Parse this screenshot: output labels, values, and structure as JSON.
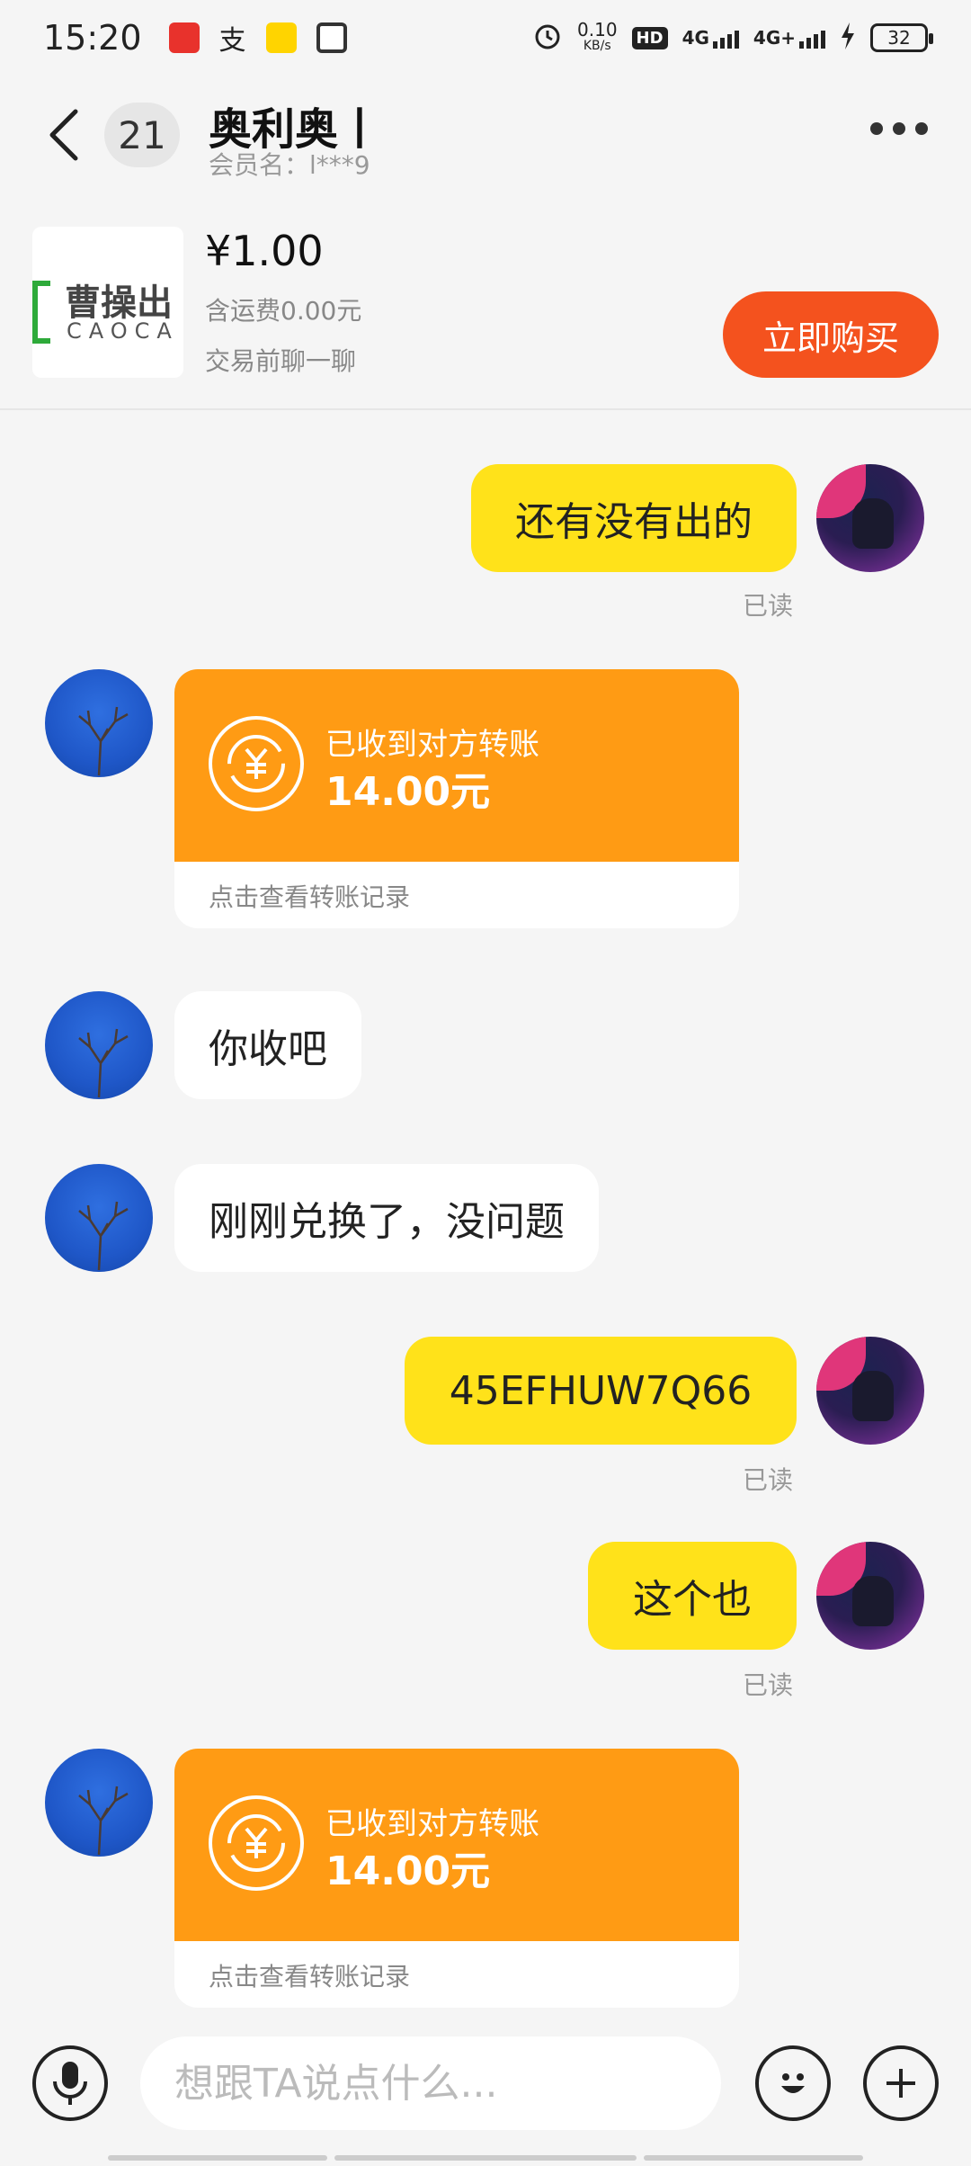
{
  "status_bar": {
    "time": "15:20",
    "net_speed_top": "0.10",
    "net_speed_bottom": "KB/s",
    "hd_label": "HD",
    "sim1_label": "4G",
    "sim2_label": "4G+",
    "battery": "32"
  },
  "header": {
    "unread_count": "21",
    "title": "奥利奥丨",
    "member_label": "会员名：l***9"
  },
  "product": {
    "logo_text_cn": "曹操出",
    "logo_text_en": "CAOCA",
    "price": "¥1.00",
    "shipping": "含运费0.00元",
    "chat_hint": "交易前聊一聊",
    "buy_label": "立即购买"
  },
  "messages": [
    {
      "side": "mine",
      "text": "还有没有出的",
      "status": "已读"
    },
    {
      "side": "theirs",
      "type": "transfer",
      "title": "已收到对方转账",
      "amount": "14.00元",
      "link": "点击查看转账记录"
    },
    {
      "side": "theirs",
      "text": "你收吧"
    },
    {
      "side": "theirs",
      "text": "刚刚兑换了，没问题"
    },
    {
      "side": "mine",
      "text": "45EFHUW7Q66",
      "status": "已读"
    },
    {
      "side": "mine",
      "text": "这个也",
      "status": "已读"
    },
    {
      "side": "theirs",
      "type": "transfer",
      "title": "已收到对方转账",
      "amount": "14.00元",
      "link": "点击查看转账记录"
    }
  ],
  "input_bar": {
    "placeholder": "想跟TA说点什么..."
  },
  "colors": {
    "mine_bubble": "#ffe21a",
    "transfer_card": "#ff9b14",
    "buy_button": "#f4521e"
  }
}
